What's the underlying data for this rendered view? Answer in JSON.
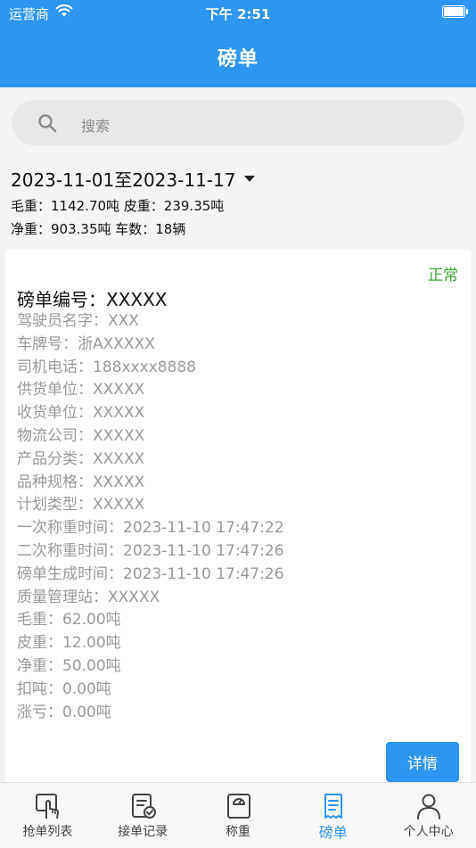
{
  "status_bar": {
    "carrier": "运营商",
    "time": "下午 2:51"
  },
  "header": {
    "title": "磅单"
  },
  "search": {
    "placeholder": "搜索"
  },
  "summary": {
    "date_range": "2023-11-01至2023-11-17",
    "line1": "毛重：1142.70吨 皮重：239.35吨",
    "line2": "净重：903.35吨 车数：18辆"
  },
  "card": {
    "status": "正常",
    "title": "磅单编号：XXXXX",
    "fields": [
      "驾驶员名字：XXX",
      "车牌号：浙AXXXXX",
      "司机电话：188xxxx8888",
      "供货单位：XXXXX",
      "收货单位：XXXXX",
      "物流公司：XXXXX",
      "产品分类：XXXXX",
      "品种规格：XXXXX",
      "计划类型：XXXXX",
      "一次称重时间：2023-11-10 17:47:22",
      "二次称重时间：2023-11-10 17:47:26",
      "磅单生成时间：2023-11-10 17:47:26",
      "质量管理站：XXXXX",
      "毛重：62.00吨",
      "皮重：12.00吨",
      "净重：50.00吨",
      "扣吨：0.00吨",
      "涨亏：0.00吨"
    ],
    "detail_label": "详情"
  },
  "tabbar": {
    "items": [
      {
        "label": "抢单列表",
        "icon": "hand-touch-icon"
      },
      {
        "label": "接单记录",
        "icon": "record-check-icon"
      },
      {
        "label": "称重",
        "icon": "scale-icon"
      },
      {
        "label": "磅单",
        "icon": "receipt-icon"
      },
      {
        "label": "个人中心",
        "icon": "person-icon"
      }
    ],
    "active_index": 3
  },
  "colors": {
    "primary": "#2e96f1",
    "status_ok": "#3fa53a"
  }
}
